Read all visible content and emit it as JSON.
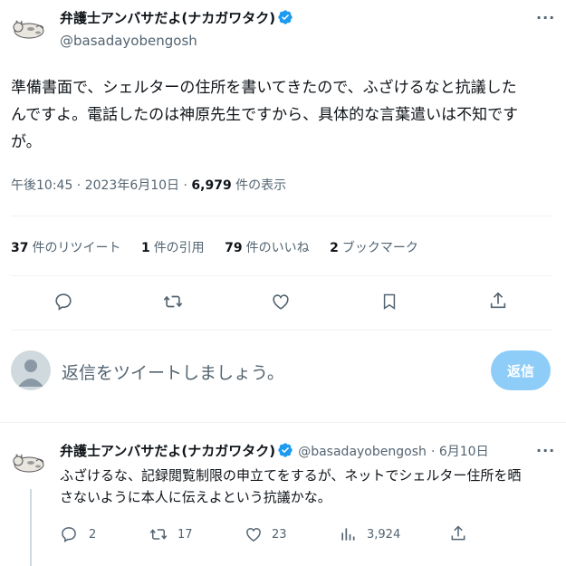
{
  "tweet": {
    "author_name": "弁護士アンバサだよ(ナカガワタク)",
    "author_handle": "@basadayobengosh",
    "more_label": "···",
    "text_line1": "準備書面で、シェルターの住所を書いてきたので、ふざけるなと抗議した",
    "text_line2": "んですよ。電話したのは神原先生ですから、具体的な言葉遣いは不知です",
    "text_line3": "が。",
    "time": "午後10:45 · 2023年6月10日 · ",
    "views_count": "6,979",
    "views_label": " 件の表示"
  },
  "stats": {
    "retweets_count": "37",
    "retweets_label": "件のリツイート",
    "quotes_count": "1",
    "quotes_label": "件の引用",
    "likes_count": "79",
    "likes_label": "件のいいね",
    "bookmarks_count": "2",
    "bookmarks_label": "ブックマーク"
  },
  "actions": {
    "icons": [
      "reply-icon",
      "retweet-icon",
      "like-icon",
      "bookmark-icon",
      "share-icon"
    ]
  },
  "composer": {
    "placeholder": "返信をツイートしましょう。",
    "button_label": "返信"
  },
  "reply": {
    "author_name": "弁護士アンバサだよ(ナカガワタク)",
    "author_handle": "@basadayobengosh",
    "date": "· 6月10日",
    "more_label": "···",
    "text_line1": "ふざけるな、記録閲覧制限の申立てをするが、ネットでシェルター住所を晒",
    "text_line2": "さないように本人に伝えよという抗議かな。",
    "reply_count": "2",
    "retweet_count": "17",
    "like_count": "23",
    "views_count": "3,924"
  },
  "colors": {
    "verified": "#1d9bf0",
    "reply_button": "#8ecdf8",
    "secondary_text": "#536471"
  }
}
